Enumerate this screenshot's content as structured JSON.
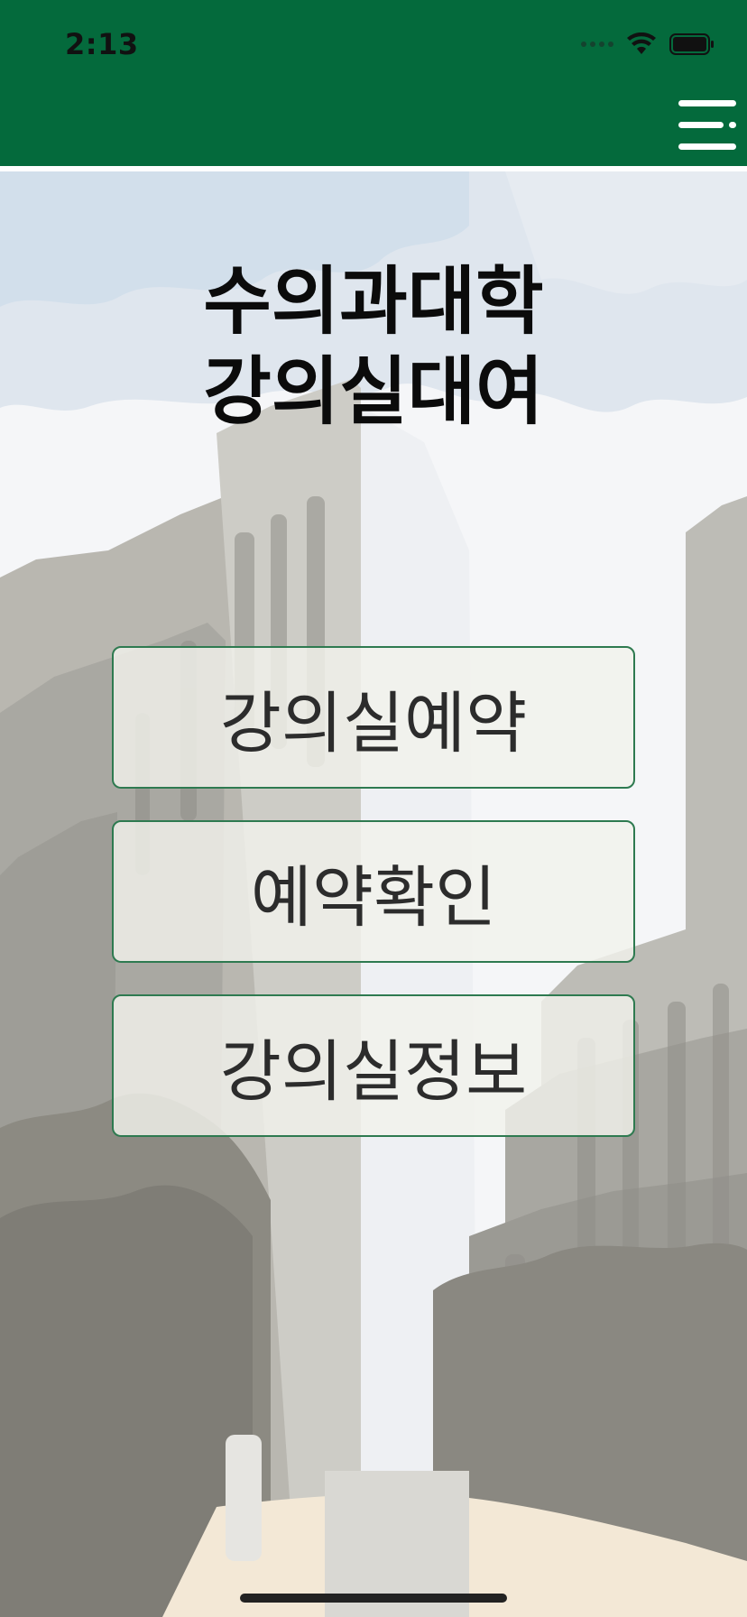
{
  "status_bar": {
    "time": "2:13",
    "signal_icon": "cellular-signal-icon",
    "wifi_icon": "wifi-icon",
    "battery_icon": "battery-icon"
  },
  "header": {
    "background_color": "#046a3c",
    "menu_icon": "hamburger-menu-icon"
  },
  "main": {
    "title_line1": "수의과대학",
    "title_line2": "강의실대여",
    "buttons": [
      {
        "label": "강의실예약"
      },
      {
        "label": "예약확인"
      },
      {
        "label": "강의실정보"
      }
    ],
    "button_border_color": "#2e7a50"
  }
}
